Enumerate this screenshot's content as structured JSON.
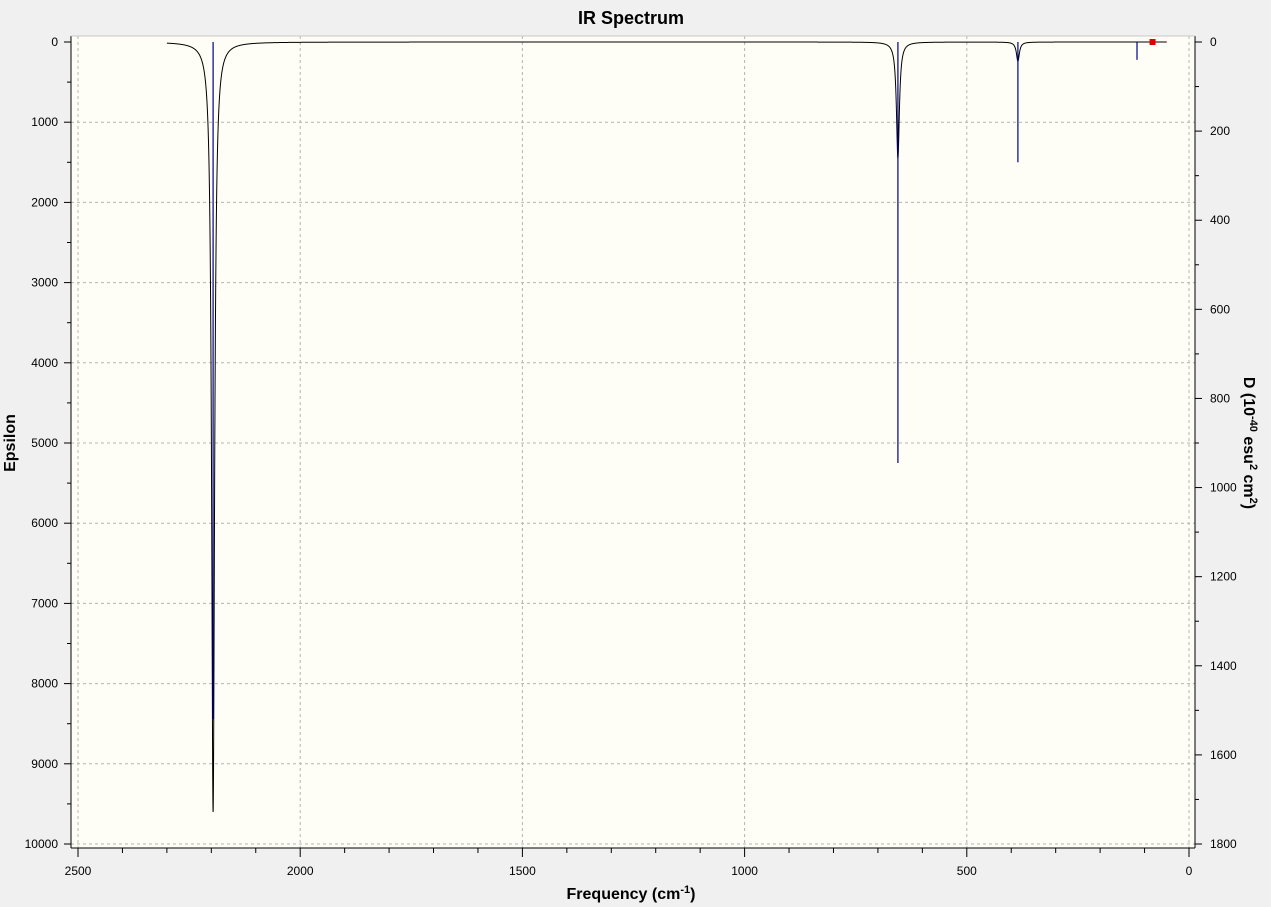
{
  "colors": {
    "window_background": "#f0f0f0",
    "plot_background": "#fefef6",
    "spectrum_line": "#000000",
    "stick_line": "#00008b",
    "grid": "#b4b4b4",
    "marker": "#e00000"
  },
  "chart_data": {
    "type": "line",
    "title": "IR Spectrum",
    "xlabel_main": "Frequency (cm",
    "xlabel_sup": "-1",
    "xlabel_close": ")",
    "ylabel_left": "Epsilon",
    "ylabel_right_parts": [
      "D (10",
      "-40",
      " esu",
      "2",
      " cm",
      "2",
      ")"
    ],
    "x_reversed": true,
    "xlim": [
      2500,
      0
    ],
    "ylim_left": [
      0,
      10000
    ],
    "ylim_right": [
      0,
      1800
    ],
    "y_inverted": true,
    "grid": true,
    "x_ticks": [
      2500,
      2000,
      1500,
      1000,
      500,
      0
    ],
    "y_left_ticks": [
      0,
      1000,
      2000,
      3000,
      4000,
      5000,
      6000,
      7000,
      8000,
      9000,
      10000
    ],
    "y_right_ticks": [
      0,
      200,
      400,
      600,
      800,
      1000,
      1200,
      1400,
      1600,
      1800
    ],
    "spectrum_range": [
      2300,
      50
    ],
    "series": [
      {
        "kind": "epsilon_curve",
        "peaks": [
          {
            "x": 2196,
            "epsilon": 9600,
            "half_width": 4
          },
          {
            "x": 655,
            "epsilon": 1450,
            "half_width": 4
          },
          {
            "x": 385,
            "epsilon": 240,
            "half_width": 4
          }
        ]
      },
      {
        "kind": "dipole_strength_sticks",
        "sticks": [
          {
            "x": 2196,
            "d": 1520
          },
          {
            "x": 655,
            "d": 945
          },
          {
            "x": 385,
            "d": 270
          },
          {
            "x": 117,
            "d": 40
          },
          {
            "x": 82,
            "d": 5
          }
        ]
      }
    ],
    "marker": {
      "x": 82,
      "d": 0
    }
  }
}
